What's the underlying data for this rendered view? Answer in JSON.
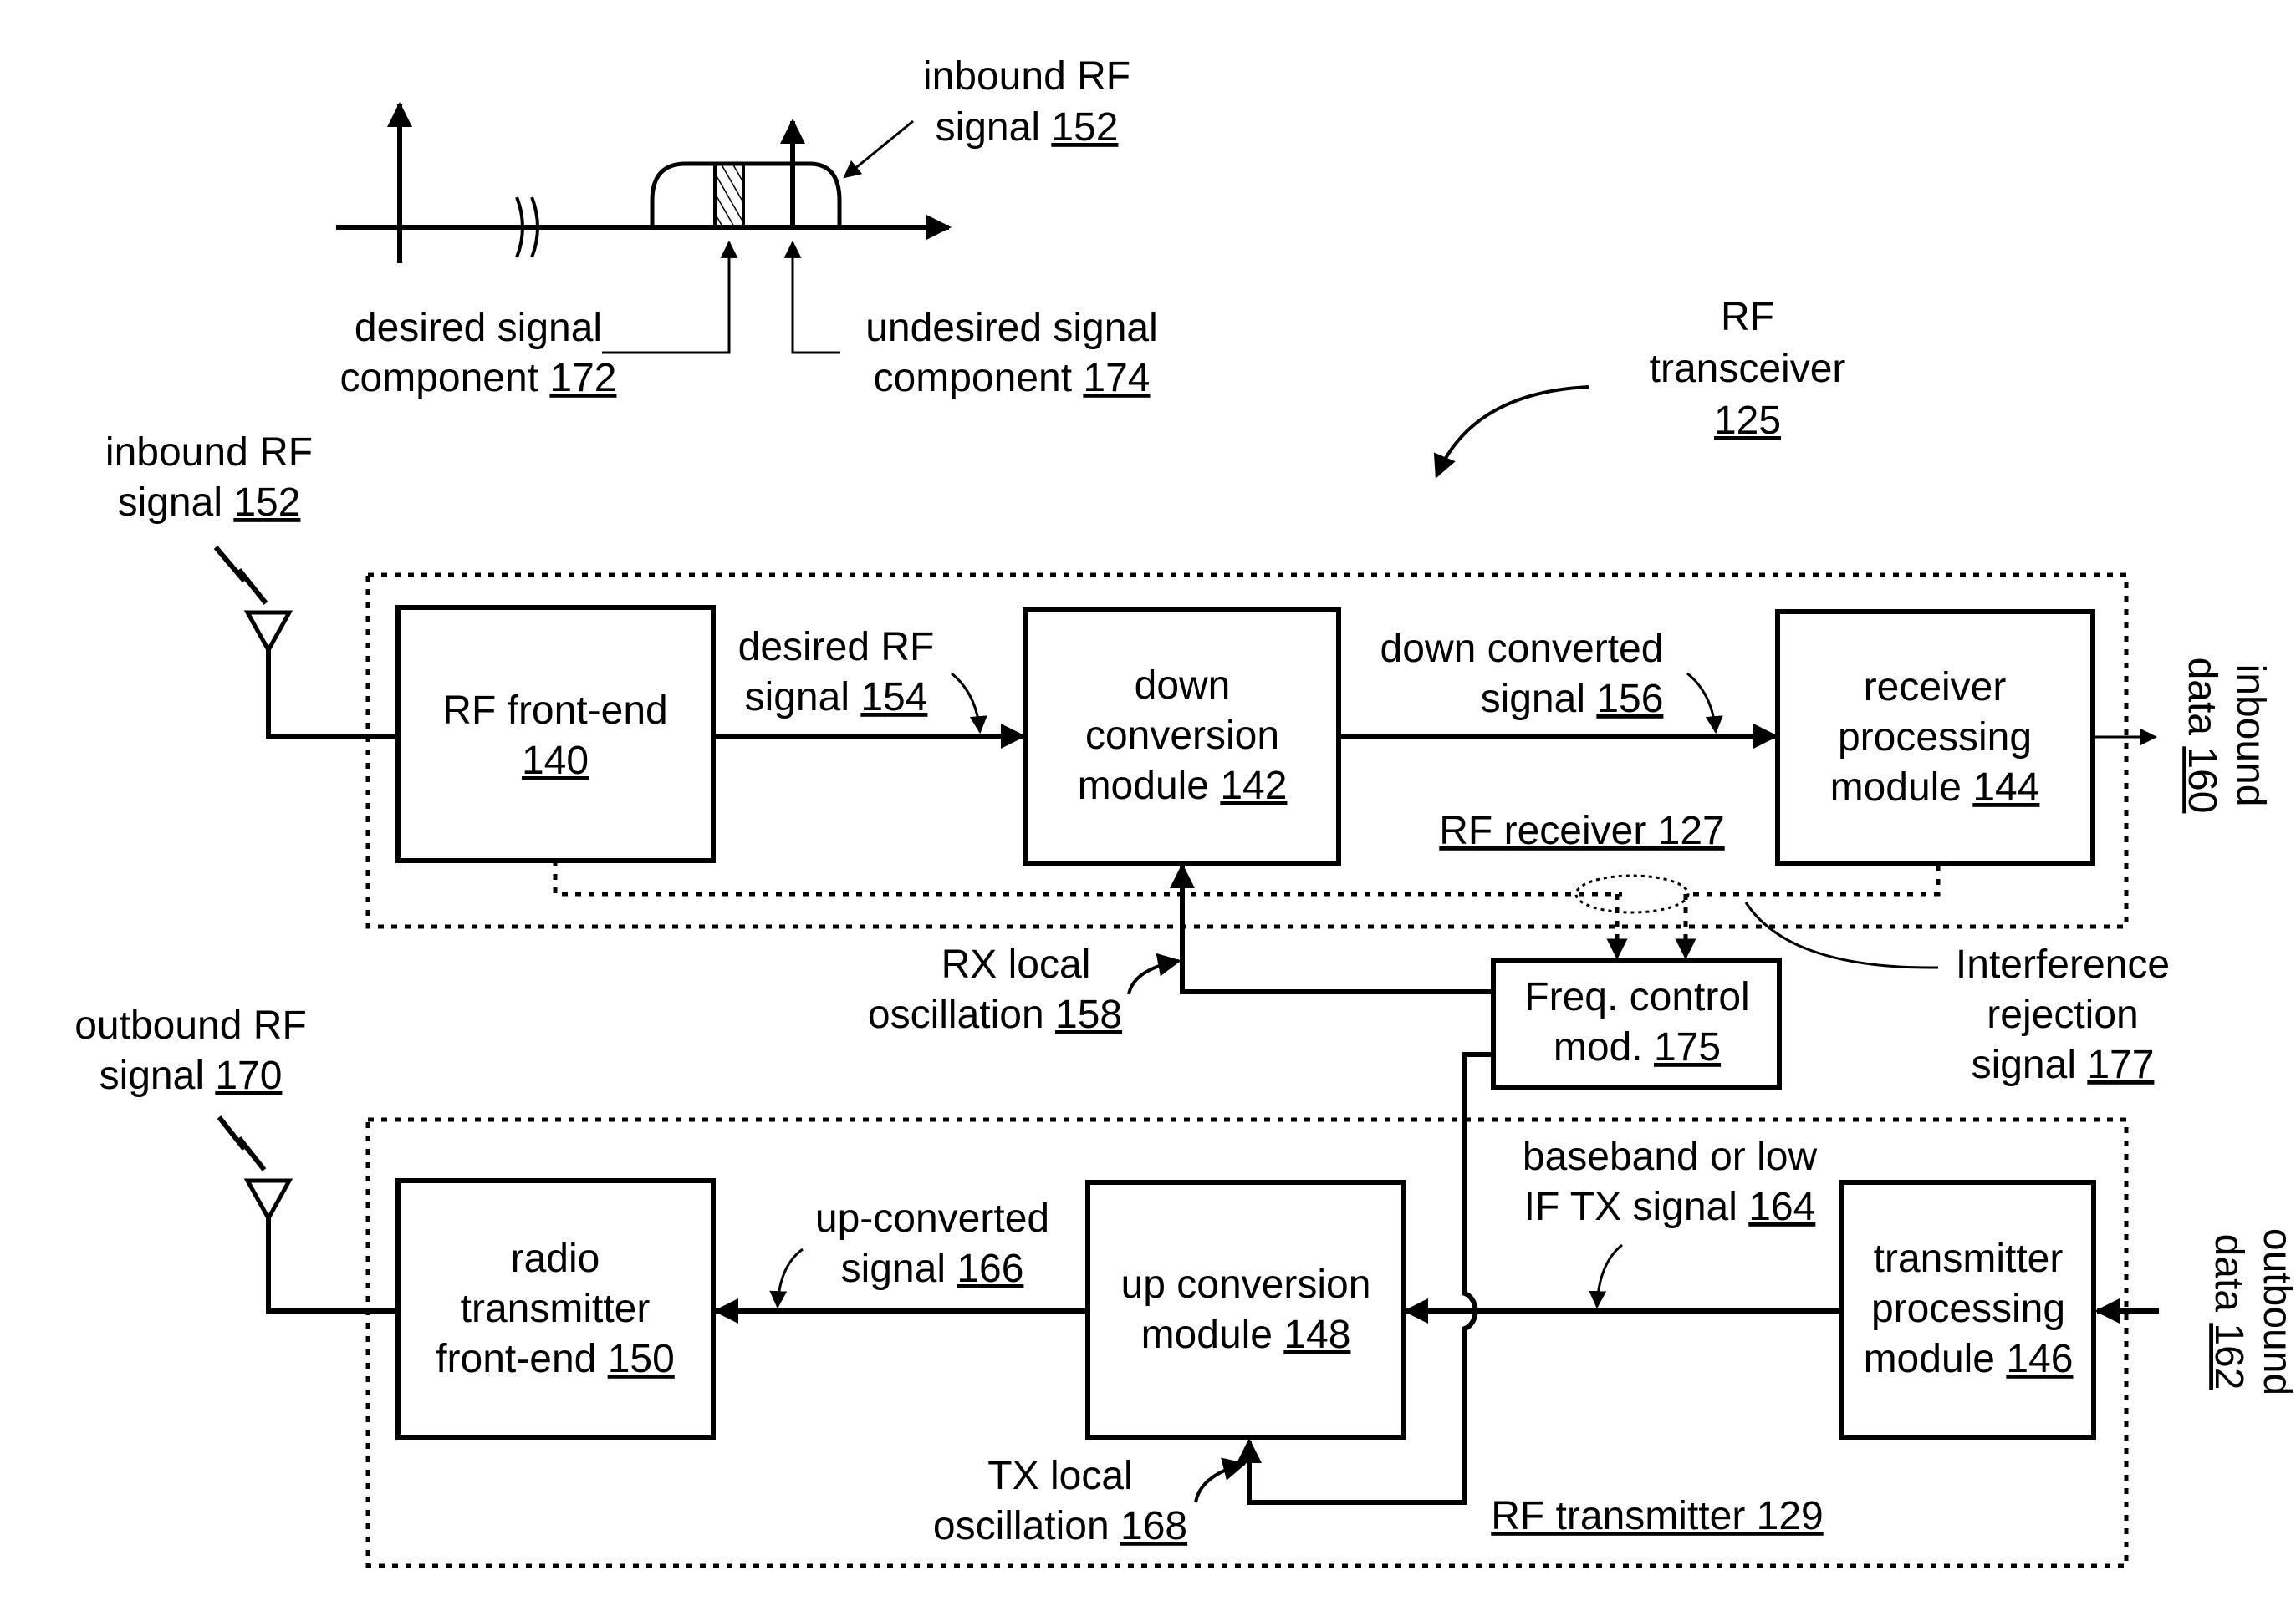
{
  "spectrum": {
    "inbound_label": [
      "inbound RF",
      "signal"
    ],
    "inbound_ref": "152",
    "desired_label": [
      "desired signal",
      "component"
    ],
    "desired_ref": "172",
    "undesired_label": [
      "undesired signal",
      "component"
    ],
    "undesired_ref": "174"
  },
  "transceiver": {
    "label": [
      "RF",
      "transceiver"
    ],
    "ref": "125"
  },
  "receiver": {
    "title": "RF receiver 127",
    "antenna_label": [
      "inbound RF",
      "signal"
    ],
    "antenna_ref": "152",
    "front_end": {
      "label": "RF front-end",
      "ref": "140"
    },
    "down_conv": {
      "label": [
        "down",
        "conversion",
        "module"
      ],
      "ref": "142"
    },
    "rx_proc": {
      "label": [
        "receiver",
        "processing",
        "module"
      ],
      "ref": "144"
    },
    "sig154": {
      "label": [
        "desired RF",
        "signal"
      ],
      "ref": "154"
    },
    "sig156": {
      "label": [
        "down converted",
        "signal"
      ],
      "ref": "156"
    },
    "inbound_data": {
      "label": "inbound",
      "label2": "data",
      "ref": "160"
    }
  },
  "freq_control": {
    "label": "Freq. control",
    "label2": "mod.",
    "ref": "175",
    "rx_lo": {
      "label": "RX local",
      "label2": "oscillation",
      "ref": "158"
    },
    "interference": {
      "label": [
        "Interference",
        "rejection",
        "signal"
      ],
      "ref": "177"
    }
  },
  "transmitter": {
    "title": "RF transmitter 129",
    "antenna_label": [
      "outbound RF",
      "signal"
    ],
    "antenna_ref": "170",
    "radio_tx": {
      "label": [
        "radio",
        "transmitter",
        "front-end"
      ],
      "ref": "150"
    },
    "up_conv": {
      "label": [
        "up conversion",
        "module"
      ],
      "ref": "148"
    },
    "tx_proc": {
      "label": [
        "transmitter",
        "processing",
        "module"
      ],
      "ref": "146"
    },
    "sig166": {
      "label": [
        "up-converted",
        "signal"
      ],
      "ref": "166"
    },
    "sig164": {
      "label": [
        "baseband or low",
        "IF TX signal"
      ],
      "ref": "164"
    },
    "tx_lo": {
      "label": "TX local",
      "label2": "oscillation",
      "ref": "168"
    },
    "outbound_data": {
      "label": "outbound",
      "label2": "data",
      "ref": "162"
    }
  }
}
